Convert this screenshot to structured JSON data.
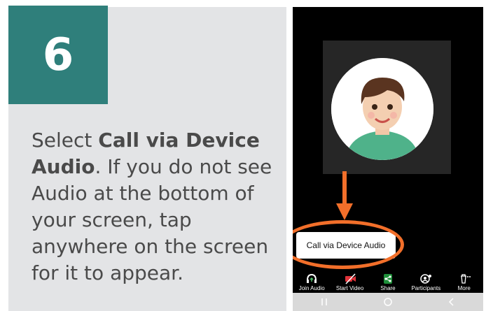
{
  "step": {
    "number": "6"
  },
  "instructions": {
    "prefix": "Select ",
    "bold": "Call via Device Audio",
    "suffix": ". If you do not see Audio at the bottom of your screen, tap anywhere on the screen for it to appear."
  },
  "phone": {
    "popup_label": "Call via Device Audio",
    "toolbar": [
      {
        "label": "Join Audio",
        "icon": "headphones-icon"
      },
      {
        "label": "Start Video",
        "icon": "video-off-icon"
      },
      {
        "label": "Share",
        "icon": "share-icon"
      },
      {
        "label": "Participants",
        "icon": "participants-icon"
      },
      {
        "label": "More",
        "icon": "more-icon"
      }
    ],
    "nav": [
      "back-icon",
      "home-icon",
      "recents-icon"
    ]
  },
  "colors": {
    "teal": "#2f7f7b",
    "orange": "#f26f2a",
    "panel": "#e3e4e6"
  }
}
